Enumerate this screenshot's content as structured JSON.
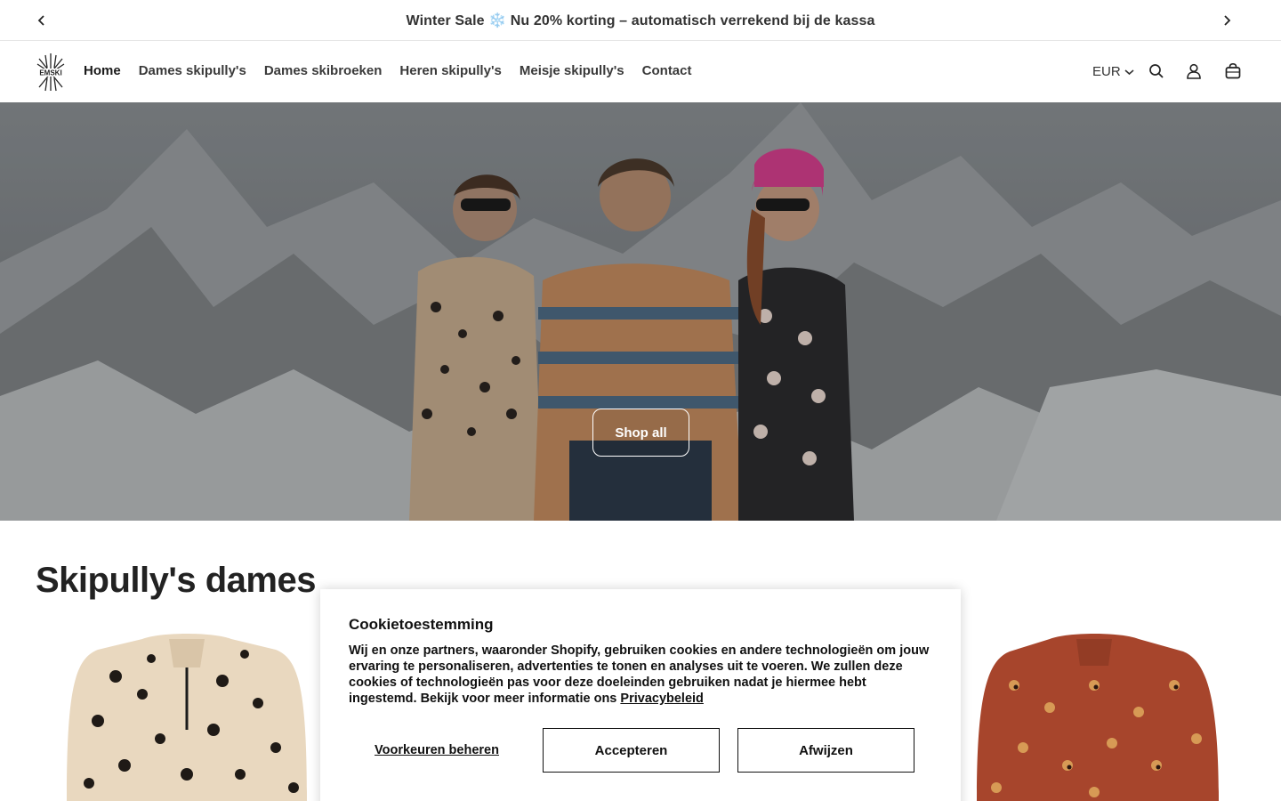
{
  "announcement": {
    "text": "Winter Sale ❄️ Nu 20% korting – automatisch verrekend bij de kassa"
  },
  "header": {
    "logo_text": "EMSKI",
    "nav": [
      {
        "label": "Home"
      },
      {
        "label": "Dames skipully's"
      },
      {
        "label": "Dames skibroeken"
      },
      {
        "label": "Heren skipully's"
      },
      {
        "label": "Meisje skipully's"
      },
      {
        "label": "Contact"
      }
    ],
    "currency": "EUR",
    "icons": [
      "search-icon",
      "account-icon",
      "cart-icon"
    ]
  },
  "hero": {
    "button_label": "Shop all"
  },
  "collection": {
    "title": "Skipully's dames"
  },
  "cookie": {
    "title": "Cookietoestemming",
    "body": "Wij en onze partners, waaronder Shopify, gebruiken cookies en andere technologieën om jouw ervaring te personaliseren, advertenties te tonen en analyses uit te voeren. We zullen deze cookies of technologieën pas voor deze doeleinden gebruiken nadat je hiermee hebt ingestemd. Bekijk voor meer informatie ons",
    "link": "Privacybeleid",
    "manage_label": "Voorkeuren beheren",
    "accept_label": "Accepteren",
    "decline_label": "Afwijzen"
  },
  "colors": {
    "text": "#1a1a1a",
    "border": "#111111",
    "hero_overlay": "#6f7376"
  }
}
